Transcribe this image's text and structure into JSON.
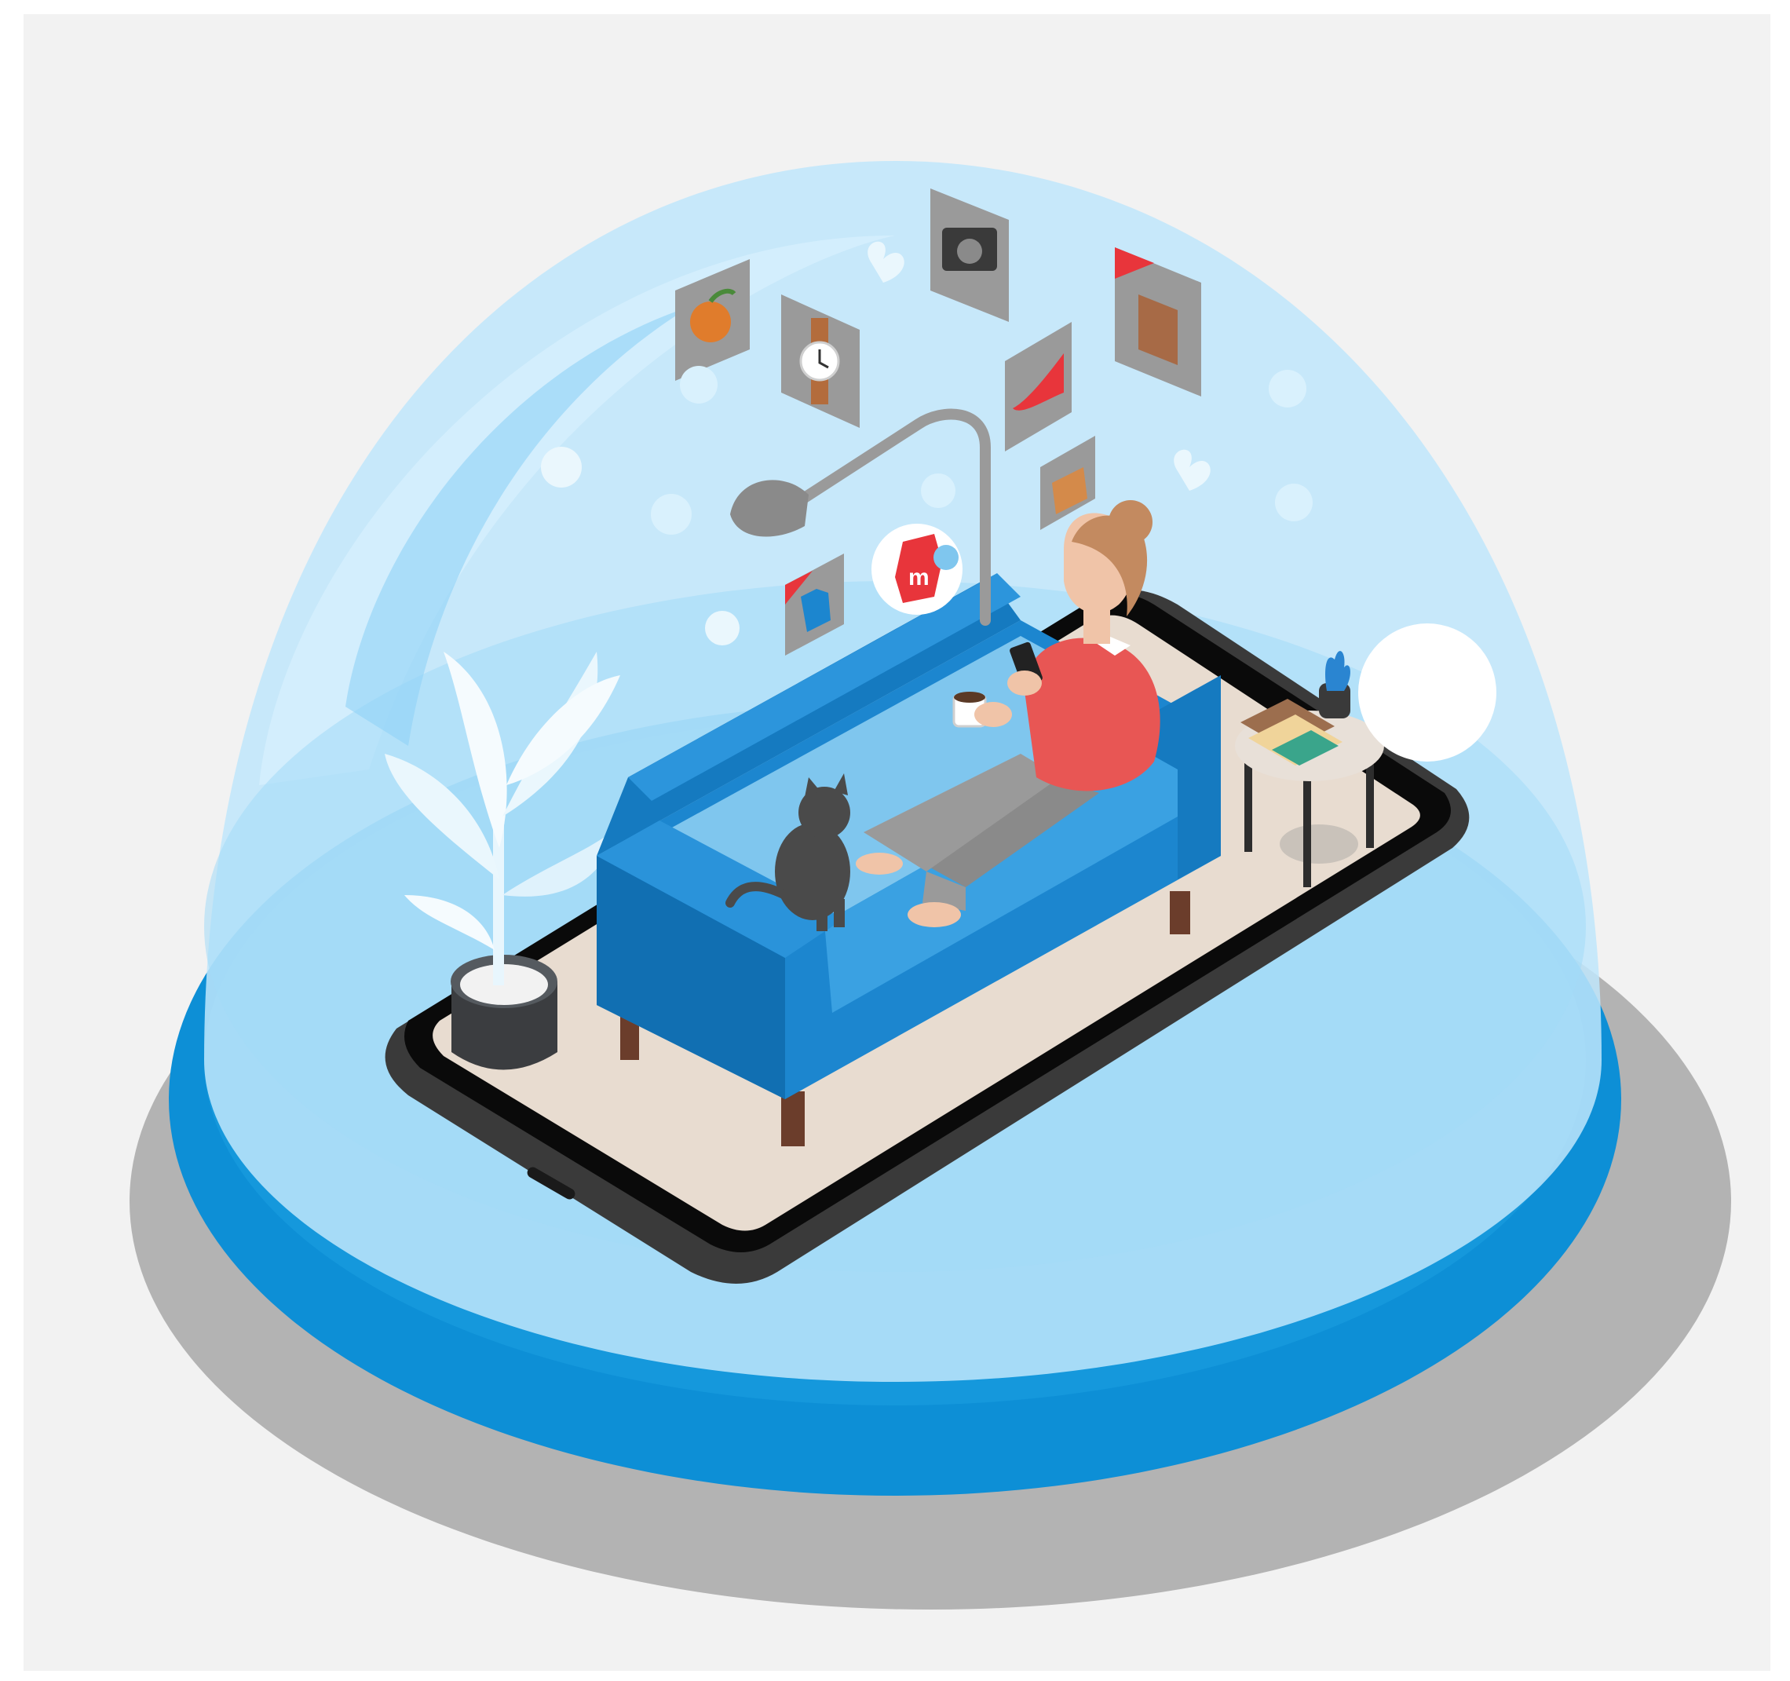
{
  "illustration": {
    "brand_logo_letter": "m",
    "colors": {
      "backdrop": "#f2f2f2",
      "base_blue": "#0d8fd6",
      "base_shadow": "#b3b3b3",
      "dome_light": "#bfe6fb",
      "sofa_blue": "#1c86cf",
      "phone_dark": "#3a3a3a",
      "screen_floor": "#e8dcd0",
      "sweater_red": "#e85654",
      "brand_red": "#e8353b",
      "frame_gray": "#9a9a9a"
    },
    "floating_icons": [
      "peach-icon",
      "watch-icon",
      "camera-icon",
      "book-icon",
      "high-heel-icon",
      "handbag-icon",
      "t-shirt-icon",
      "heart-icon",
      "smiley-icon",
      "chat-bubble-icon"
    ]
  }
}
